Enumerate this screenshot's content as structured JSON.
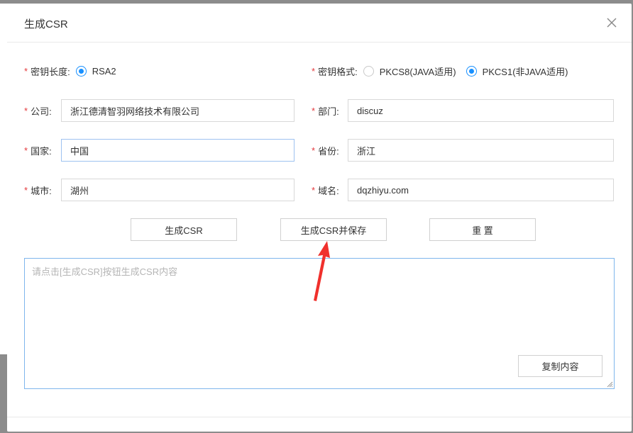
{
  "dialog": {
    "title": "生成CSR",
    "close_icon": "close-icon"
  },
  "form": {
    "key_length": {
      "required_mark": "*",
      "label": "密钥长度:",
      "options": [
        {
          "label": "RSA2",
          "checked": true
        }
      ]
    },
    "key_format": {
      "required_mark": "*",
      "label": "密钥格式:",
      "options": [
        {
          "label": "PKCS8(JAVA适用)",
          "checked": false
        },
        {
          "label": "PKCS1(非JAVA适用)",
          "checked": true
        }
      ]
    },
    "company": {
      "required_mark": "*",
      "label": "公司:",
      "value": "浙江德清智羽网络技术有限公司"
    },
    "department": {
      "required_mark": "*",
      "label": "部门:",
      "value": "discuz"
    },
    "country": {
      "required_mark": "*",
      "label": "国家:",
      "value": "中国"
    },
    "province": {
      "required_mark": "*",
      "label": "省份:",
      "value": "浙江"
    },
    "city": {
      "required_mark": "*",
      "label": "城市:",
      "value": "湖州"
    },
    "domain": {
      "required_mark": "*",
      "label": "域名:",
      "value": "dqzhiyu.com"
    }
  },
  "buttons": {
    "generate": "生成CSR",
    "generate_save": "生成CSR并保存",
    "reset": "重 置",
    "copy": "复制内容"
  },
  "output": {
    "placeholder": "请点击[生成CSR]按钮生成CSR内容"
  },
  "colors": {
    "accent": "#1890ff",
    "required": "#e4393c",
    "annotation_arrow": "#f0302c"
  }
}
